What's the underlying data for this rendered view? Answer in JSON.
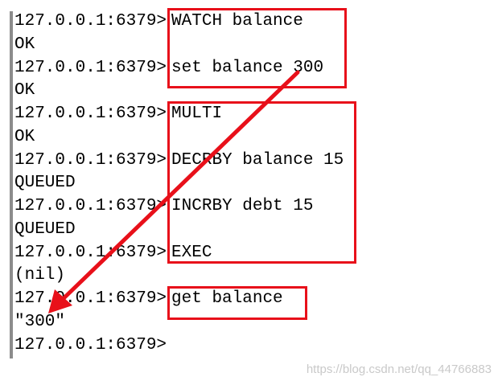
{
  "terminal": {
    "lines": [
      {
        "type": "prompt",
        "prompt": "127.0.0.1:6379>",
        "command": "WATCH balance"
      },
      {
        "type": "output",
        "text": "OK"
      },
      {
        "type": "prompt",
        "prompt": "127.0.0.1:6379>",
        "command": "set balance 300"
      },
      {
        "type": "output",
        "text": "OK"
      },
      {
        "type": "prompt",
        "prompt": "127.0.0.1:6379>",
        "command": "MULTI"
      },
      {
        "type": "output",
        "text": "OK"
      },
      {
        "type": "prompt",
        "prompt": "127.0.0.1:6379>",
        "command": "DECRBY balance 15"
      },
      {
        "type": "output",
        "text": "QUEUED"
      },
      {
        "type": "prompt",
        "prompt": "127.0.0.1:6379>",
        "command": "INCRBY debt 15"
      },
      {
        "type": "output",
        "text": "QUEUED"
      },
      {
        "type": "prompt",
        "prompt": "127.0.0.1:6379>",
        "command": "EXEC"
      },
      {
        "type": "output",
        "text": "(nil)"
      },
      {
        "type": "prompt",
        "prompt": "127.0.0.1:6379>",
        "command": "get balance"
      },
      {
        "type": "output",
        "text": "\"300\""
      },
      {
        "type": "prompt",
        "prompt": "127.0.0.1:6379>",
        "command": ""
      }
    ]
  },
  "annotations": {
    "box_color": "#e8101a",
    "arrow_color": "#e8101a"
  },
  "watermark": {
    "text": "https://blog.csdn.net/qq_44766883"
  }
}
